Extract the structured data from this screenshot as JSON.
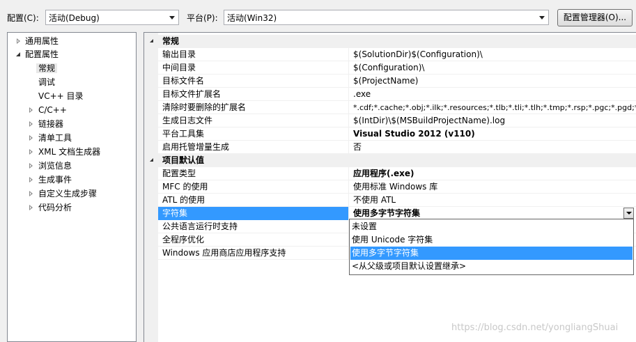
{
  "toolbar": {
    "config_label": "配置(C):",
    "config_value": "活动(Debug)",
    "platform_label": "平台(P):",
    "platform_value": "活动(Win32)",
    "manager_button": "配置管理器(O)..."
  },
  "tree": {
    "items": [
      {
        "label": "通用属性"
      },
      {
        "label": "配置属性"
      },
      {
        "label": "常规"
      },
      {
        "label": "调试"
      },
      {
        "label": "VC++ 目录"
      },
      {
        "label": "C/C++"
      },
      {
        "label": "链接器"
      },
      {
        "label": "清单工具"
      },
      {
        "label": "XML 文档生成器"
      },
      {
        "label": "浏览信息"
      },
      {
        "label": "生成事件"
      },
      {
        "label": "自定义生成步骤"
      },
      {
        "label": "代码分析"
      }
    ]
  },
  "grid": {
    "cat1": "常规",
    "general": [
      {
        "name": "输出目录",
        "value": "$(SolutionDir)$(Configuration)\\"
      },
      {
        "name": "中间目录",
        "value": "$(Configuration)\\"
      },
      {
        "name": "目标文件名",
        "value": "$(ProjectName)"
      },
      {
        "name": "目标文件扩展名",
        "value": ".exe"
      },
      {
        "name": "清除时要删除的扩展名",
        "value": "*.cdf;*.cache;*.obj;*.ilk;*.resources;*.tlb;*.tli;*.tlh;*.tmp;*.rsp;*.pgc;*.pgd;*"
      },
      {
        "name": "生成日志文件",
        "value": "$(IntDir)\\$(MSBuildProjectName).log"
      },
      {
        "name": "平台工具集",
        "value": "Visual Studio 2012 (v110)"
      },
      {
        "name": "启用托管增量生成",
        "value": "否"
      }
    ],
    "cat2": "项目默认值",
    "defaults": [
      {
        "name": "配置类型",
        "value": "应用程序(.exe)"
      },
      {
        "name": "MFC 的使用",
        "value": "使用标准 Windows 库"
      },
      {
        "name": "ATL 的使用",
        "value": "不使用 ATL"
      },
      {
        "name": "字符集",
        "value": "使用多字节字符集"
      },
      {
        "name": "公共语言运行时支持",
        "value": ""
      },
      {
        "name": "全程序优化",
        "value": ""
      },
      {
        "name": "Windows 应用商店应用程序支持",
        "value": ""
      }
    ]
  },
  "dropdown": {
    "options": [
      {
        "label": "未设置"
      },
      {
        "label": "使用 Unicode 字符集"
      },
      {
        "label": "使用多字节字符集"
      },
      {
        "label": "<从父级或项目默认设置继承>"
      }
    ]
  },
  "watermark": "https://blog.csdn.net/yongliangShuai"
}
